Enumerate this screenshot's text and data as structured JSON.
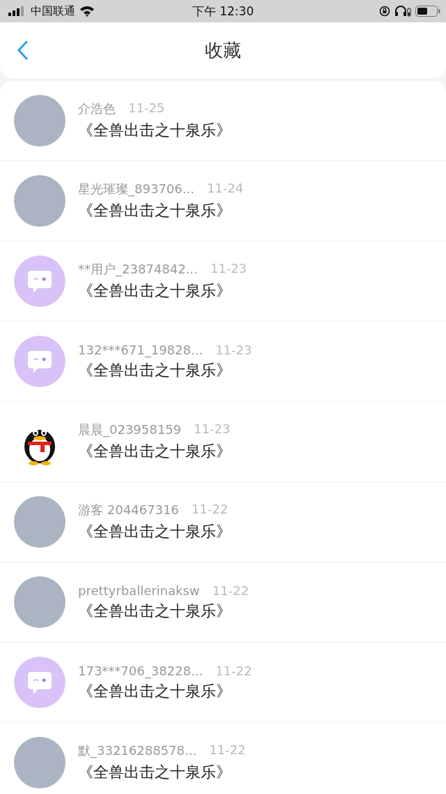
{
  "status_bar": {
    "carrier": "中国联通",
    "time": "下午 12:30"
  },
  "nav": {
    "title": "收藏"
  },
  "items": [
    {
      "kind": "photo",
      "name": "介浩色",
      "date": "11-25",
      "title": "《全兽出击之十泉乐》"
    },
    {
      "kind": "photo",
      "name": "星光璀璨_893706...",
      "date": "11-24",
      "title": "《全兽出击之十泉乐》"
    },
    {
      "kind": "bubble",
      "name": "**用户_23874842...",
      "date": "11-23",
      "title": "《全兽出击之十泉乐》"
    },
    {
      "kind": "bubble",
      "name": "132***671_19828...",
      "date": "11-23",
      "title": "《全兽出击之十泉乐》"
    },
    {
      "kind": "penguin",
      "name": "晨晨_023958159",
      "date": "11-23",
      "title": "《全兽出击之十泉乐》"
    },
    {
      "kind": "photo",
      "name": "游客 204467316",
      "date": "11-22",
      "title": "《全兽出击之十泉乐》"
    },
    {
      "kind": "photo",
      "name": "prettyrballerinaksw",
      "date": "11-22",
      "title": "《全兽出击之十泉乐》"
    },
    {
      "kind": "bubble",
      "name": "173***706_38228...",
      "date": "11-22",
      "title": "《全兽出击之十泉乐》"
    },
    {
      "kind": "photo",
      "name": "默_33216288578...",
      "date": "11-22",
      "title": "《全兽出击之十泉乐》"
    }
  ]
}
